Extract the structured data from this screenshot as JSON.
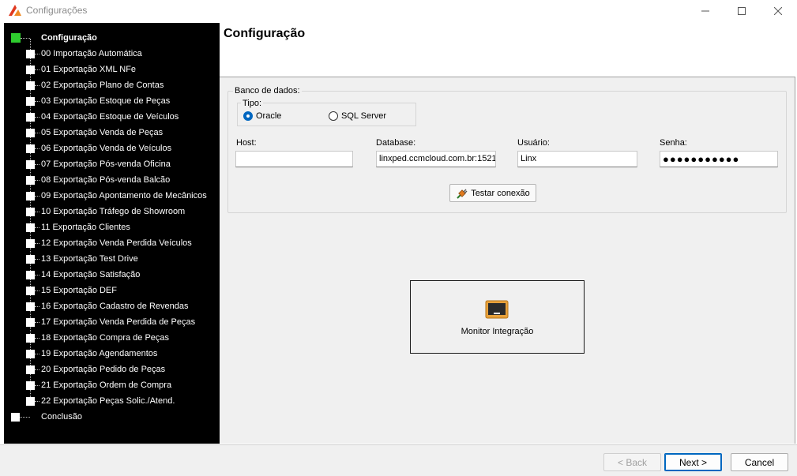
{
  "window": {
    "title": "Configurações",
    "colors": {
      "accent": "#0067c0",
      "tree_background": "#000000",
      "tree_active_node": "#2ecc2e",
      "content_background": "#f0f0f0"
    }
  },
  "tree": {
    "root": {
      "label": "Configuração",
      "icon": "green-square-icon"
    },
    "items": [
      {
        "label": "00 Importação Automática"
      },
      {
        "label": "01 Exportação XML NFe"
      },
      {
        "label": "02 Exportação Plano de Contas"
      },
      {
        "label": "03 Exportação Estoque de Peças"
      },
      {
        "label": "04 Exportação Estoque de Veículos"
      },
      {
        "label": "05 Exportação Venda de Peças"
      },
      {
        "label": "06 Exportação Venda de Veículos"
      },
      {
        "label": "07 Exportação Pós-venda Oficina"
      },
      {
        "label": "08 Exportação Pós-venda Balcão"
      },
      {
        "label": "09 Exportação Apontamento de Mecânicos"
      },
      {
        "label": "10 Exportação Tráfego de Showroom"
      },
      {
        "label": "11 Exportação Clientes"
      },
      {
        "label": "12 Exportação Venda Perdida Veículos"
      },
      {
        "label": "13 Exportação Test Drive"
      },
      {
        "label": "14 Exportação Satisfação"
      },
      {
        "label": "15 Exportação DEF"
      },
      {
        "label": "16 Exportação Cadastro de Revendas"
      },
      {
        "label": "17 Exportação Venda Perdida de Peças"
      },
      {
        "label": "18 Exportação Compra de Peças"
      },
      {
        "label": "19 Exportação Agendamentos"
      },
      {
        "label": "20 Exportação Pedido de Peças"
      },
      {
        "label": "21 Exportação Ordem de Compra"
      },
      {
        "label": "22 Exportação Peças Solic./Atend."
      }
    ],
    "end": {
      "label": "Conclusão"
    }
  },
  "page": {
    "title": "Configuração"
  },
  "database": {
    "group_label": "Banco de dados:",
    "type_group_label": "Tipo:",
    "types": [
      {
        "label": "Oracle",
        "selected": true
      },
      {
        "label": "SQL Server",
        "selected": false
      }
    ],
    "host": {
      "label": "Host:",
      "value": ""
    },
    "database": {
      "label": "Database:",
      "value": "linxped.ccmcloud.com.br:1521"
    },
    "user": {
      "label": "Usuário:",
      "value": "Linx"
    },
    "password": {
      "label": "Senha:",
      "value": "●●●●●●●●●●●"
    },
    "test_button": {
      "label": "Testar conexão",
      "icon": "plug-icon"
    }
  },
  "monitor": {
    "label": "Monitor Integração",
    "icon": "monitor-icon"
  },
  "footer": {
    "back_label": "< Back",
    "next_label": "Next >",
    "cancel_label": "Cancel"
  }
}
